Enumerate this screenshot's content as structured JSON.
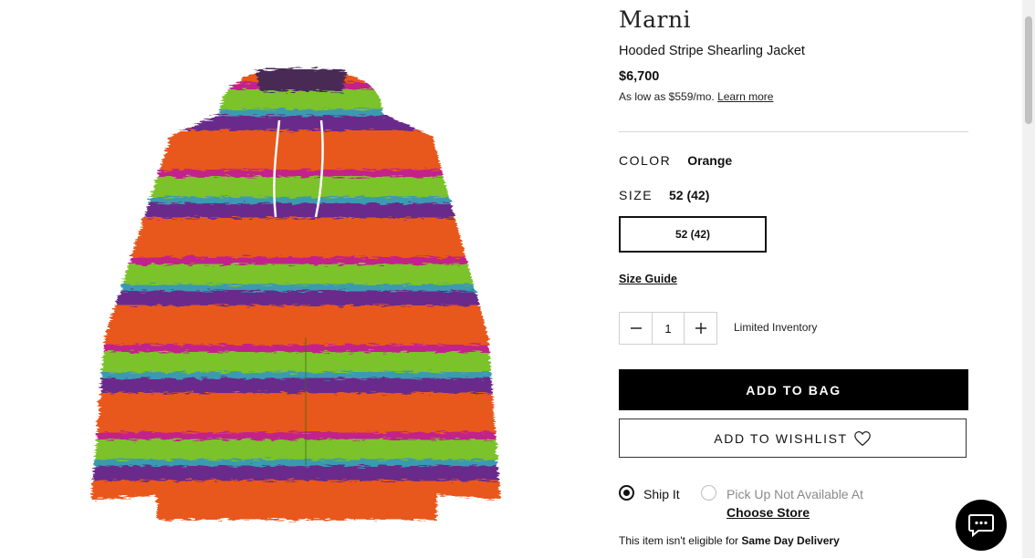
{
  "product": {
    "brand": "Marni",
    "name": "Hooded Stripe Shearling Jacket",
    "price": "$6,700",
    "financing_text": "As low as $559/mo.",
    "financing_link": "Learn more"
  },
  "color": {
    "label": "COLOR",
    "value": "Orange"
  },
  "size": {
    "label": "SIZE",
    "value": "52 (42)",
    "options": [
      "52 (42)"
    ]
  },
  "size_guide": "Size Guide",
  "quantity": {
    "value": "1",
    "note": "Limited Inventory"
  },
  "buttons": {
    "add_to_bag": "ADD TO BAG",
    "add_to_wishlist": "ADD TO WISHLIST"
  },
  "delivery": {
    "ship": "Ship It",
    "pickup": "Pick Up Not Available At",
    "choose_store": "Choose Store",
    "sameday_prefix": "This item isn't eligible for ",
    "sameday_bold": "Same Day Delivery"
  },
  "icons": {
    "heart": "heart-icon",
    "chat": "chat-icon",
    "minus": "minus-icon",
    "plus": "plus-icon"
  },
  "colors": {
    "accent": "#000000",
    "stripe_orange": "#e8581c",
    "stripe_green": "#7cc22a",
    "stripe_purple": "#6a2a8c",
    "stripe_magenta": "#c2208a",
    "stripe_teal": "#3a9ab0"
  }
}
